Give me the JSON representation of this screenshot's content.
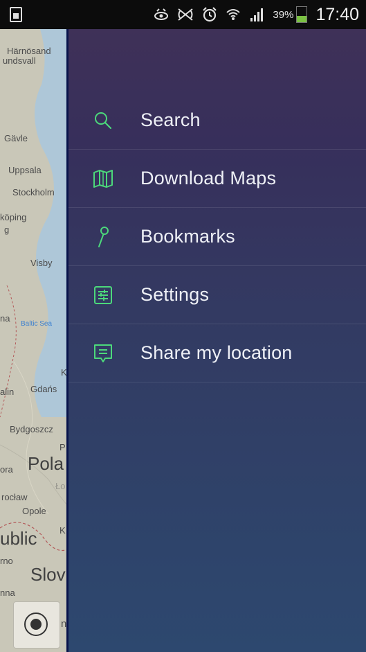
{
  "status_bar": {
    "battery_percent": "39%",
    "battery_level": 0.39,
    "time": "17:40",
    "icons": [
      "sim-card-icon",
      "eye-icon",
      "nfc-icon",
      "alarm-icon",
      "wifi-icon",
      "signal-icon",
      "battery-icon"
    ]
  },
  "map": {
    "labels": {
      "harnosand": "Härnösand",
      "sundsvall": "undsvall",
      "gavle": "Gävle",
      "uppsala": "Uppsala",
      "stockholm": "Stockholm",
      "koping": "köping",
      "g": "g",
      "visby": "Visby",
      "na": "na",
      "baltic_sea": "Baltic Sea",
      "k": "K",
      "alin": "alin",
      "gdansk": "Gdańs",
      "bydgoszcz": "Bydgoszcz",
      "p": "P",
      "ora": "ora",
      "pola": "Pola",
      "lo": "Ło",
      "wroclaw": "rocław",
      "opole": "Opole",
      "ublic": "ublic",
      "k2": "K",
      "rno": "rno",
      "slov": "Slov",
      "nna": "nna",
      "n": "n"
    },
    "colors": {
      "land": "#c9c7b8",
      "sea": "#a8c3d8",
      "border": "#b35a5a"
    }
  },
  "drawer": {
    "accent_color": "#4cd97b",
    "items": [
      {
        "label": "Search",
        "icon": "search-icon"
      },
      {
        "label": "Download Maps",
        "icon": "map-icon"
      },
      {
        "label": "Bookmarks",
        "icon": "pin-icon"
      },
      {
        "label": "Settings",
        "icon": "settings-sliders-icon"
      },
      {
        "label": "Share my location",
        "icon": "share-location-icon"
      }
    ]
  }
}
